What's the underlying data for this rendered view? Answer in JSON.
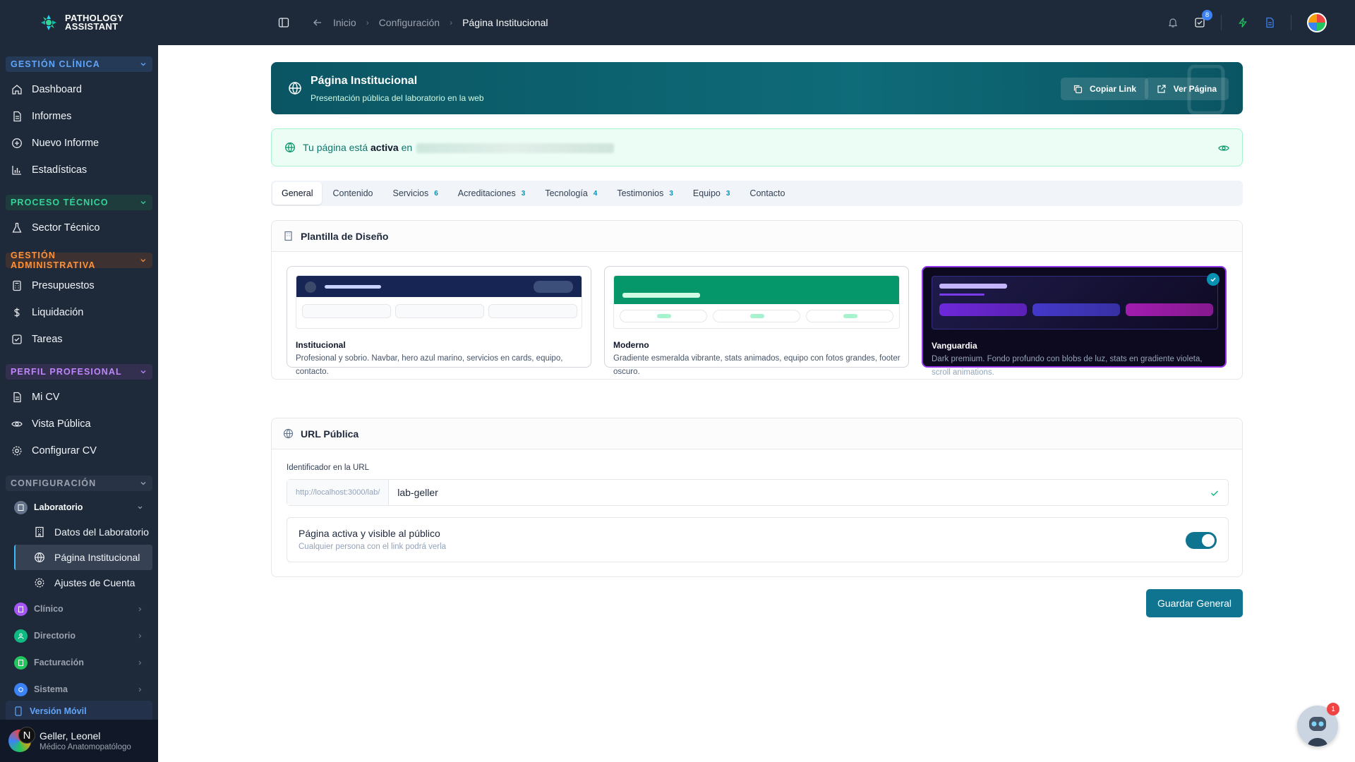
{
  "brand": {
    "line1": "PATHOLOGY",
    "line2": "ASSISTANT"
  },
  "sidebar": {
    "sections": [
      {
        "label": "GESTIÓN CLÍNICA",
        "color": "#60a5fa",
        "bg": "#253a57"
      },
      {
        "label": "PROCESO TÉCNICO",
        "color": "#34d399",
        "bg": "#1f3c3d"
      },
      {
        "label": "GESTIÓN ADMINISTRATIVA",
        "color": "#fb923c",
        "bg": "#3d3131"
      },
      {
        "label": "PERFIL PROFESIONAL",
        "color": "#c084fc",
        "bg": "#33304f"
      },
      {
        "label": "CONFIGURACIÓN",
        "color": "#9ca3af",
        "bg": "#283446"
      }
    ],
    "items": {
      "dashboard": "Dashboard",
      "informes": "Informes",
      "nuevo_informe": "Nuevo Informe",
      "estadisticas": "Estadísticas",
      "sector_tecnico": "Sector Técnico",
      "presupuestos": "Presupuestos",
      "liquidacion": "Liquidación",
      "tareas": "Tareas",
      "mi_cv": "Mi CV",
      "vista_publica": "Vista Pública",
      "configurar_cv": "Configurar CV"
    },
    "groups": {
      "laboratorio": "Laboratorio",
      "clinico": "Clínico",
      "directorio": "Directorio",
      "facturacion": "Facturación",
      "sistema": "Sistema"
    },
    "sub_items": {
      "datos_lab": "Datos del Laboratorio",
      "pagina_inst": "Página Institucional",
      "ajustes": "Ajustes de Cuenta"
    },
    "mobile": "Versión Móvil",
    "user": {
      "initial": "N",
      "name": "Geller, Leonel",
      "role": "Médico Anatomopatólogo"
    }
  },
  "topbar": {
    "breadcrumb": [
      "Inicio",
      "Configuración",
      "Página Institucional"
    ],
    "tasks_badge": "8"
  },
  "header": {
    "title": "Página Institucional",
    "subtitle": "Presentación pública del laboratorio en la web",
    "copy_btn": "Copiar Link",
    "view_btn": "Ver Página"
  },
  "banner": {
    "text_pre": "Tu página está",
    "text_bold": "activa",
    "text_post": "en"
  },
  "tabs": [
    {
      "label": "General",
      "count": ""
    },
    {
      "label": "Contenido",
      "count": ""
    },
    {
      "label": "Servicios",
      "count": "6"
    },
    {
      "label": "Acreditaciones",
      "count": "3"
    },
    {
      "label": "Tecnología",
      "count": "4"
    },
    {
      "label": "Testimonios",
      "count": "3"
    },
    {
      "label": "Equipo",
      "count": "3"
    },
    {
      "label": "Contacto",
      "count": ""
    }
  ],
  "templates_card": {
    "title": "Plantilla de Diseño",
    "templates": [
      {
        "name": "Institucional",
        "desc": "Profesional y sobrio. Navbar, hero azul marino, servicios en cards, equipo, contacto."
      },
      {
        "name": "Moderno",
        "desc": "Gradiente esmeralda vibrante, stats animados, equipo con fotos grandes, footer oscuro."
      },
      {
        "name": "Vanguardia",
        "desc": "Dark premium. Fondo profundo con blobs de luz, stats en gradiente violeta, scroll animations."
      }
    ]
  },
  "url_card": {
    "title": "URL Pública",
    "field_label": "Identificador en la URL",
    "prefix": "http://localhost:3000/lab/",
    "value": "lab-geller",
    "toggle_title": "Página activa y visible al público",
    "toggle_sub": "Cualquier persona con el link podrá verla",
    "toggle_on": true
  },
  "save_button": "Guardar General",
  "assistant_badge": "1",
  "colors": {
    "accent": "#0e7490",
    "sidebar_bg": "#1e2939",
    "selected_template": "#9333ea"
  }
}
